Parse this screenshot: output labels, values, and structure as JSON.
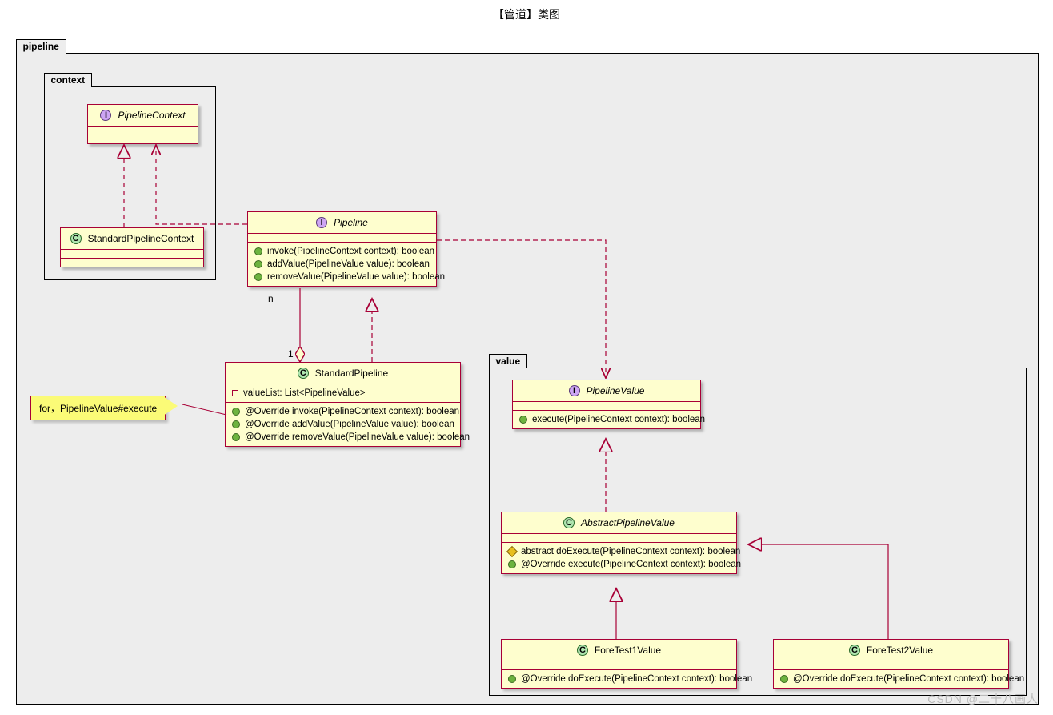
{
  "title": "【管道】类图",
  "watermark": "CSDN @二十八画人",
  "pkg": {
    "pipeline": "pipeline",
    "context": "context",
    "value": "value"
  },
  "cls": {
    "PipelineContext": {
      "name": "PipelineContext"
    },
    "StandardPipelineContext": {
      "name": "StandardPipelineContext"
    },
    "Pipeline": {
      "name": "Pipeline",
      "m1": "invoke(PipelineContext context): boolean",
      "m2": "addValue(PipelineValue value): boolean",
      "m3": "removeValue(PipelineValue value): boolean"
    },
    "StandardPipeline": {
      "name": "StandardPipeline",
      "f1": "valueList: List<PipelineValue>",
      "m1": "@Override invoke(PipelineContext context): boolean",
      "m2": "@Override addValue(PipelineValue value): boolean",
      "m3": "@Override removeValue(PipelineValue value): boolean"
    },
    "PipelineValue": {
      "name": "PipelineValue",
      "m1": "execute(PipelineContext context): boolean"
    },
    "AbstractPipelineValue": {
      "name": "AbstractPipelineValue",
      "m1": "abstract doExecute(PipelineContext context): boolean",
      "m2": "@Override execute(PipelineContext context): boolean"
    },
    "ForeTest1Value": {
      "name": "ForeTest1Value",
      "m1": "@Override doExecute(PipelineContext context): boolean"
    },
    "ForeTest2Value": {
      "name": "ForeTest2Value",
      "m1": "@Override doExecute(PipelineContext context): boolean"
    }
  },
  "note": {
    "text": "for，PipelineValue#execute"
  },
  "labels": {
    "one": "1",
    "n": "n"
  },
  "chart_data": {
    "type": "uml_class_diagram",
    "title": "【管道】类图",
    "packages": [
      {
        "name": "pipeline",
        "children": [
          "Pipeline",
          "StandardPipeline",
          "context",
          "value"
        ]
      },
      {
        "name": "context",
        "parent": "pipeline",
        "children": [
          "PipelineContext",
          "StandardPipelineContext"
        ]
      },
      {
        "name": "value",
        "parent": "pipeline",
        "children": [
          "PipelineValue",
          "AbstractPipelineValue",
          "ForeTest1Value",
          "ForeTest2Value"
        ]
      }
    ],
    "classes": [
      {
        "name": "PipelineContext",
        "stereotype": "interface",
        "package": "context"
      },
      {
        "name": "StandardPipelineContext",
        "stereotype": "class",
        "package": "context"
      },
      {
        "name": "Pipeline",
        "stereotype": "interface",
        "package": "pipeline",
        "operations": [
          "invoke(PipelineContext context): boolean",
          "addValue(PipelineValue value): boolean",
          "removeValue(PipelineValue value): boolean"
        ]
      },
      {
        "name": "StandardPipeline",
        "stereotype": "class",
        "package": "pipeline",
        "attributes": [
          "valueList: List<PipelineValue>"
        ],
        "operations": [
          "@Override invoke(PipelineContext context): boolean",
          "@Override addValue(PipelineValue value): boolean",
          "@Override removeValue(PipelineValue value): boolean"
        ],
        "notes": [
          "for，PipelineValue#execute"
        ]
      },
      {
        "name": "PipelineValue",
        "stereotype": "interface",
        "package": "value",
        "operations": [
          "execute(PipelineContext context): boolean"
        ]
      },
      {
        "name": "AbstractPipelineValue",
        "stereotype": "class",
        "abstract": true,
        "package": "value",
        "operations": [
          "abstract doExecute(PipelineContext context): boolean",
          "@Override execute(PipelineContext context): boolean"
        ]
      },
      {
        "name": "ForeTest1Value",
        "stereotype": "class",
        "package": "value",
        "operations": [
          "@Override doExecute(PipelineContext context): boolean"
        ]
      },
      {
        "name": "ForeTest2Value",
        "stereotype": "class",
        "package": "value",
        "operations": [
          "@Override doExecute(PipelineContext context): boolean"
        ]
      }
    ],
    "relationships": [
      {
        "from": "StandardPipelineContext",
        "to": "PipelineContext",
        "type": "realization"
      },
      {
        "from": "Pipeline",
        "to": "PipelineContext",
        "type": "dependency"
      },
      {
        "from": "StandardPipeline",
        "to": "Pipeline",
        "type": "realization"
      },
      {
        "from": "StandardPipeline",
        "to": "Pipeline",
        "type": "aggregation",
        "from_mult": "1",
        "to_mult": "n"
      },
      {
        "from": "Pipeline",
        "to": "PipelineValue",
        "type": "dependency"
      },
      {
        "from": "AbstractPipelineValue",
        "to": "PipelineValue",
        "type": "realization"
      },
      {
        "from": "ForeTest1Value",
        "to": "AbstractPipelineValue",
        "type": "generalization"
      },
      {
        "from": "ForeTest2Value",
        "to": "AbstractPipelineValue",
        "type": "generalization"
      }
    ]
  }
}
